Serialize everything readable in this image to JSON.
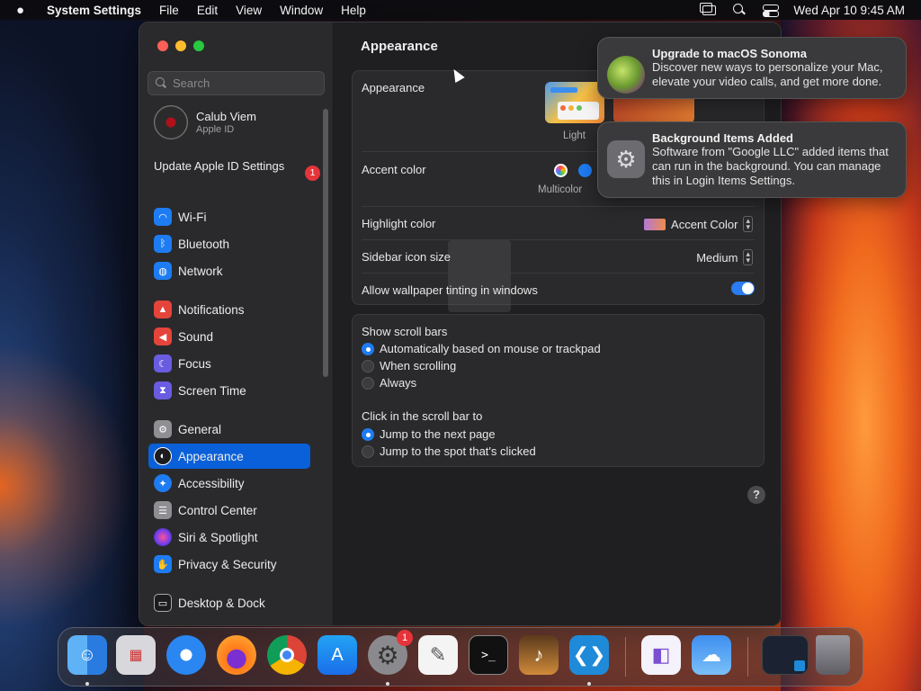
{
  "menubar": {
    "app_name": "System Settings",
    "menus": [
      "File",
      "Edit",
      "View",
      "Window",
      "Help"
    ],
    "clock": "Wed Apr 10  9:45 AM"
  },
  "sidebar": {
    "search_placeholder": "Search",
    "user": {
      "name": "Calub Viem",
      "subtitle": "Apple ID"
    },
    "update": {
      "label": "Update Apple ID Settings",
      "badge": "1"
    },
    "items": [
      {
        "label": "Wi-Fi",
        "icon": "wifi-icon",
        "color": "#1e7cf2"
      },
      {
        "label": "Bluetooth",
        "icon": "bluetooth-icon",
        "color": "#1e7cf2"
      },
      {
        "label": "Network",
        "icon": "globe-icon",
        "color": "#1e7cf2"
      },
      {
        "label": "Notifications",
        "icon": "bell-icon",
        "color": "#e5443a"
      },
      {
        "label": "Sound",
        "icon": "speaker-icon",
        "color": "#e5443a"
      },
      {
        "label": "Focus",
        "icon": "moon-icon",
        "color": "#6a5ce0"
      },
      {
        "label": "Screen Time",
        "icon": "hourglass-icon",
        "color": "#6a5ce0"
      },
      {
        "label": "General",
        "icon": "gear-icon",
        "color": "#8e8e93"
      },
      {
        "label": "Appearance",
        "icon": "appearance-icon",
        "color": "#1c1c1e"
      },
      {
        "label": "Accessibility",
        "icon": "accessibility-icon",
        "color": "#1e7cf2"
      },
      {
        "label": "Control Center",
        "icon": "control-center-icon",
        "color": "#8e8e93"
      },
      {
        "label": "Siri & Spotlight",
        "icon": "siri-icon",
        "color": "#b04fd8"
      },
      {
        "label": "Privacy & Security",
        "icon": "hand-icon",
        "color": "#1e7cf2"
      },
      {
        "label": "Desktop & Dock",
        "icon": "dock-icon",
        "color": "#1c1c1e"
      }
    ],
    "selected": "Appearance"
  },
  "main": {
    "title": "Appearance",
    "appearance": {
      "label": "Appearance",
      "light_label": "Light"
    },
    "accent": {
      "label": "Accent color",
      "multicolor_label": "Multicolor"
    },
    "highlight": {
      "label": "Highlight color",
      "value": "Accent Color"
    },
    "sidebar_icon_size": {
      "label": "Sidebar icon size",
      "value": "Medium"
    },
    "wallpaper_tinting": {
      "label": "Allow wallpaper tinting in windows",
      "enabled": true
    },
    "scroll_bars": {
      "label": "Show scroll bars",
      "options": [
        "Automatically based on mouse or trackpad",
        "When scrolling",
        "Always"
      ],
      "selected": 0
    },
    "click_scroll": {
      "label": "Click in the scroll bar to",
      "options": [
        "Jump to the next page",
        "Jump to the spot that's clicked"
      ],
      "selected": 0
    },
    "help": "?"
  },
  "notifications": [
    {
      "title": "Upgrade to macOS Sonoma",
      "body": "Discover new ways to personalize your Mac, elevate your video calls, and get more done."
    },
    {
      "title": "Background Items Added",
      "body": "Software from \"Google LLC\" added items that can run in the background. You can manage this in Login Items Settings."
    }
  ],
  "dock": {
    "settings_badge": "1",
    "apps": [
      "finder-icon",
      "launchpad-icon",
      "safari-icon",
      "firefox-icon",
      "chrome-icon",
      "app-store-icon",
      "system-settings-icon",
      "textedit-icon",
      "terminal-icon",
      "garageband-icon",
      "vscode-icon",
      "visual-studio-icon",
      "weather-icon",
      "window-preview-icon",
      "trash-icon"
    ]
  }
}
